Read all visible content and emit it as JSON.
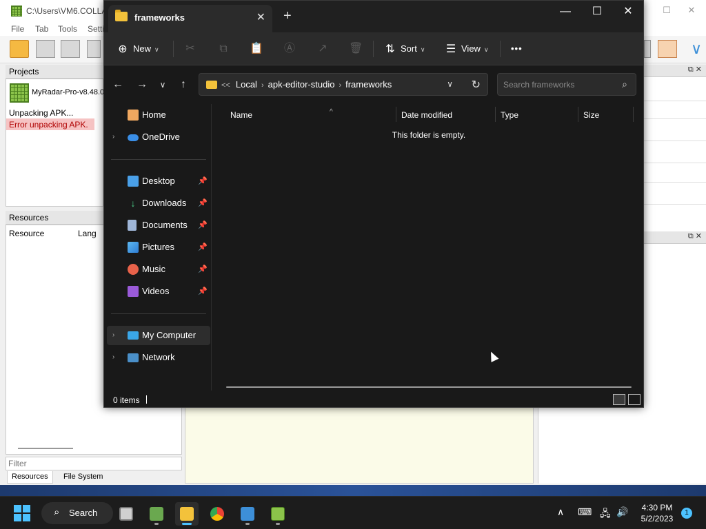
{
  "background_app": {
    "title": "C:\\Users\\VM6.COLLA",
    "menu": [
      "File",
      "Tab",
      "Tools",
      "Setti"
    ],
    "projects_header": "Projects",
    "project_name": "MyRadar-Pro-v8.48.0",
    "log": [
      "Unpacking APK...",
      "Error unpacking APK."
    ],
    "resources_header": "Resources",
    "resource_columns": [
      "Resource",
      "Lang"
    ],
    "filter_placeholder": "Filter",
    "bottom_tabs": [
      "Resources",
      "File System"
    ]
  },
  "explorer": {
    "tab_title": "frameworks",
    "toolbar": {
      "new_label": "New",
      "sort_label": "Sort",
      "view_label": "View",
      "more_label": "•••"
    },
    "address": {
      "overflow": "<<",
      "crumbs": [
        "Local",
        "apk-editor-studio",
        "frameworks"
      ]
    },
    "search_placeholder": "Search frameworks",
    "nav": {
      "home": "Home",
      "onedrive": "OneDrive",
      "desktop": "Desktop",
      "downloads": "Downloads",
      "documents": "Documents",
      "pictures": "Pictures",
      "music": "Music",
      "videos": "Videos",
      "my_computer": "My Computer",
      "network": "Network"
    },
    "columns": {
      "name": "Name",
      "date_modified": "Date modified",
      "type": "Type",
      "size": "Size"
    },
    "empty_message": "This folder is empty.",
    "status_count": "0 items"
  },
  "taskbar": {
    "search_label": "Search",
    "time": "4:30 PM",
    "date": "5/2/2023",
    "notification_count": "1"
  },
  "colors": {
    "explorer_bg": "#191919",
    "accent": "#4cc2ff",
    "error_bg": "#f6c3c3",
    "folder": "#f3c23b"
  }
}
